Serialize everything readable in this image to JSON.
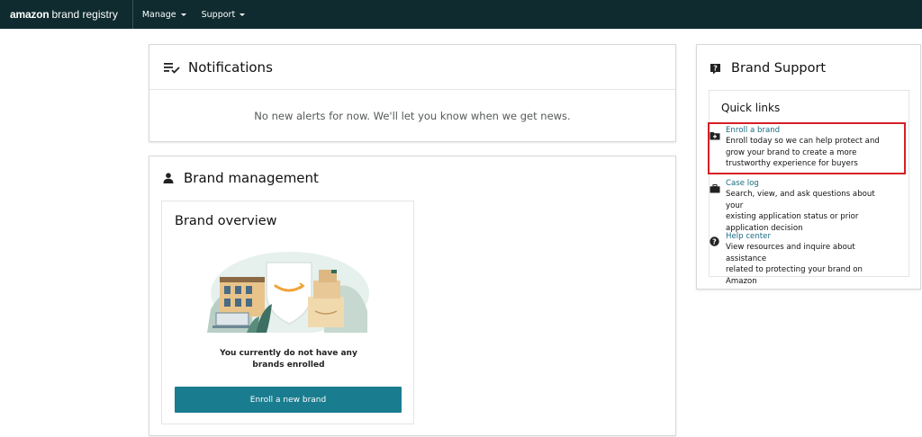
{
  "nav": {
    "logo_amazon": "amazon",
    "logo_registry": "brand registry",
    "manage_label": "Manage",
    "support_label": "Support"
  },
  "notifications": {
    "title": "Notifications",
    "empty_message": "No new alerts for now. We'll let you know when we get news."
  },
  "brand_management": {
    "title": "Brand management",
    "overview_title": "Brand overview",
    "empty_line1": "You currently do not have any",
    "empty_line2": "brands enrolled",
    "enroll_button": "Enroll a new brand"
  },
  "brand_support": {
    "title": "Brand Support",
    "quick_links_title": "Quick links",
    "links": [
      {
        "label": "Enroll a brand",
        "desc_lines": [
          "Enroll today so we can help protect and",
          "grow your brand to create a more",
          "trustworthy experience for buyers"
        ],
        "icon": "folder-plus-icon"
      },
      {
        "label": "Case log",
        "desc_lines": [
          "Search, view, and ask questions about your",
          "existing application status or prior",
          "application decision"
        ],
        "icon": "briefcase-icon"
      },
      {
        "label": "Help center",
        "desc_lines": [
          "View resources and inquire about assistance",
          "related to protecting your brand on Amazon"
        ],
        "icon": "question-circle-icon"
      }
    ]
  },
  "colors": {
    "topbar": "#0f2b2f",
    "button": "#1a7c8f",
    "link": "#1a6c82",
    "highlight": "#d61f26"
  }
}
